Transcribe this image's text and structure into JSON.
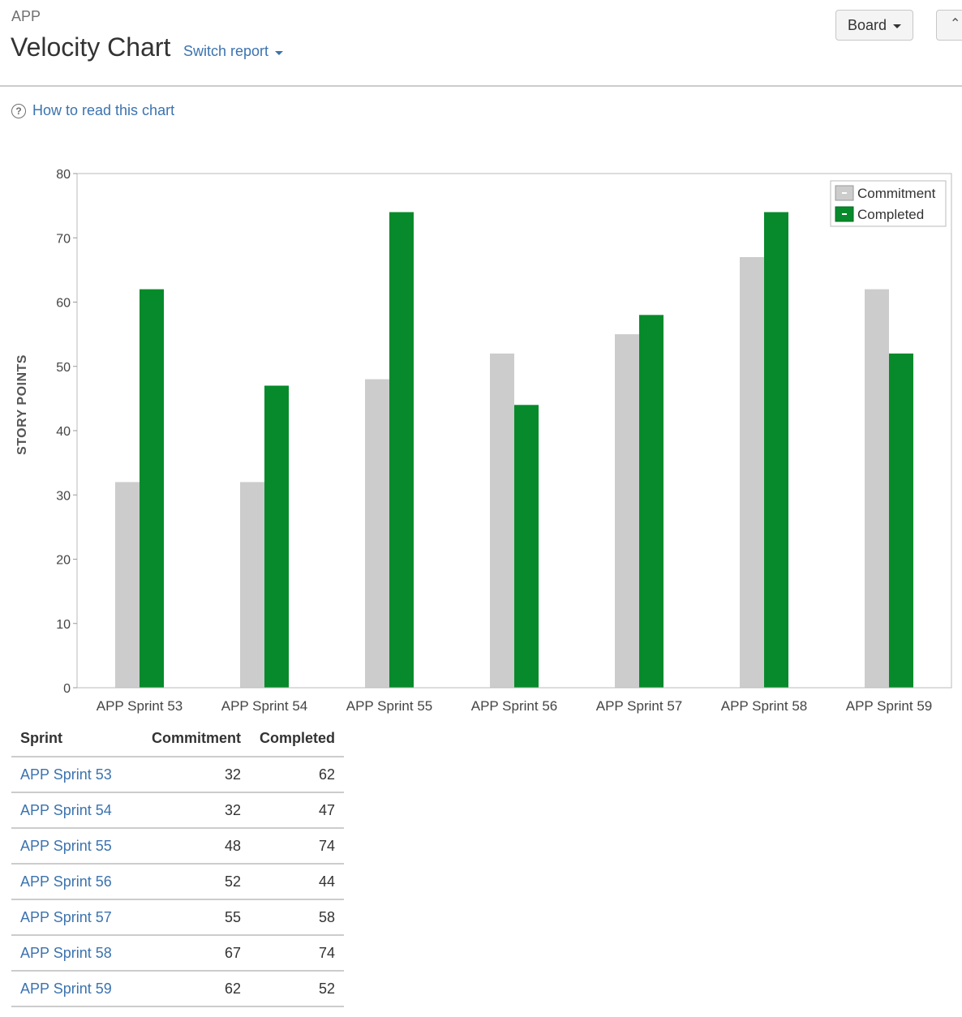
{
  "header": {
    "project_key": "APP",
    "title": "Velocity Chart",
    "switch_report": "Switch report",
    "board_button": "Board",
    "expand_icon": "double-chevron-up-icon"
  },
  "help": {
    "link": "How to read this chart",
    "icon": "question-circle-icon"
  },
  "colors": {
    "commitment": "#cccccc",
    "completed": "#078a2b",
    "link": "#3b73af"
  },
  "chart_data": {
    "type": "bar",
    "title": "",
    "xlabel": "",
    "ylabel": "STORY POINTS",
    "ylim": [
      0,
      80
    ],
    "yticks": [
      0,
      10,
      20,
      30,
      40,
      50,
      60,
      70,
      80
    ],
    "legend_position": "top-right",
    "categories": [
      "APP Sprint 53",
      "APP Sprint 54",
      "APP Sprint 55",
      "APP Sprint 56",
      "APP Sprint 57",
      "APP Sprint 58",
      "APP Sprint 59"
    ],
    "series": [
      {
        "name": "Commitment",
        "color": "#cccccc",
        "values": [
          32,
          32,
          48,
          52,
          55,
          67,
          62
        ]
      },
      {
        "name": "Completed",
        "color": "#078a2b",
        "values": [
          62,
          47,
          74,
          44,
          58,
          74,
          52
        ]
      }
    ]
  },
  "table": {
    "headers": {
      "sprint": "Sprint",
      "commitment": "Commitment",
      "completed": "Completed"
    },
    "rows": [
      {
        "sprint": "APP Sprint 53",
        "commitment": "32",
        "completed": "62"
      },
      {
        "sprint": "APP Sprint 54",
        "commitment": "32",
        "completed": "47"
      },
      {
        "sprint": "APP Sprint 55",
        "commitment": "48",
        "completed": "74"
      },
      {
        "sprint": "APP Sprint 56",
        "commitment": "52",
        "completed": "44"
      },
      {
        "sprint": "APP Sprint 57",
        "commitment": "55",
        "completed": "58"
      },
      {
        "sprint": "APP Sprint 58",
        "commitment": "67",
        "completed": "74"
      },
      {
        "sprint": "APP Sprint 59",
        "commitment": "62",
        "completed": "52"
      }
    ]
  }
}
